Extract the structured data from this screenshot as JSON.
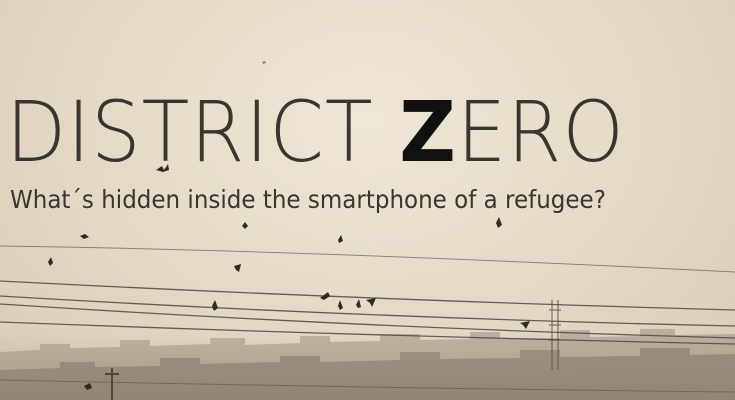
{
  "title": {
    "part1": "DISTRICT ",
    "part2": "Z",
    "part3": "ERO"
  },
  "subtitle": "What´s hidden inside the smartphone of a refugee?",
  "colors": {
    "sky": "#e6dccb",
    "text": "#2a2622",
    "accent_letter": "#111111",
    "silhouette": "#6f665c"
  }
}
